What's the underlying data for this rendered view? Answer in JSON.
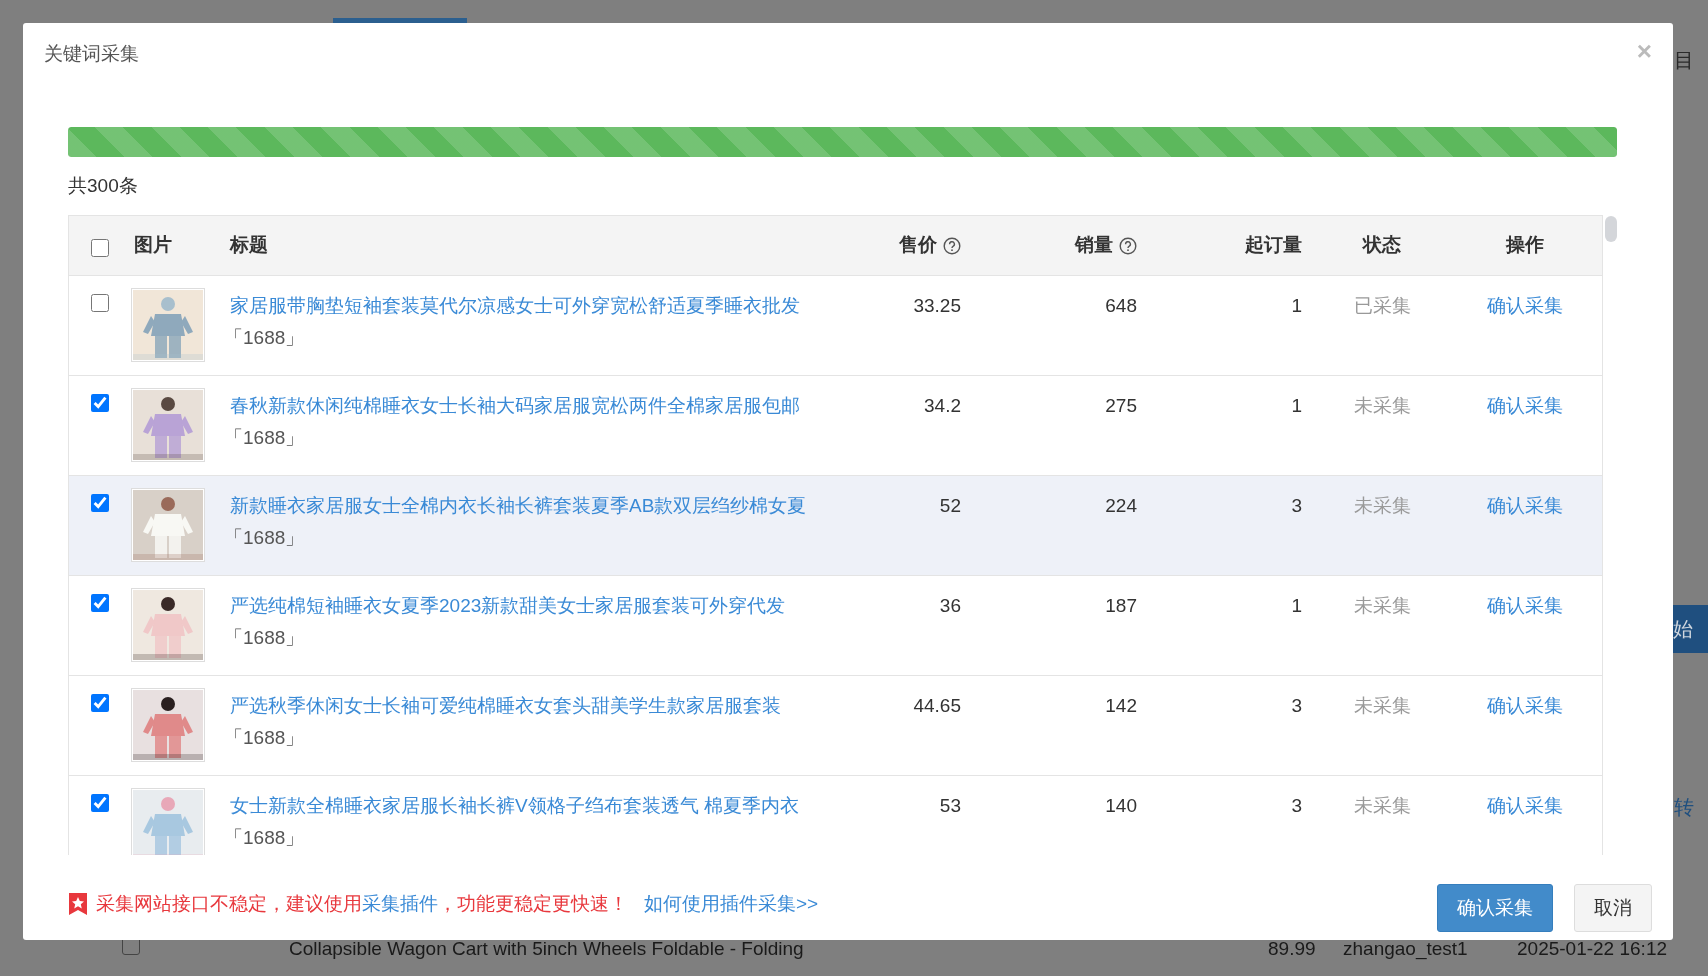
{
  "background": {
    "side_text": "目",
    "side_button": "始",
    "side_link": "转",
    "row": {
      "checked": false,
      "title": "Collapsible Wagon Cart with 5inch Wheels Foldable - Folding",
      "price": "89.99",
      "user": "zhangao_test1",
      "time": "2025-01-22 16:12"
    }
  },
  "dialog": {
    "title": "关键词采集",
    "close": "×",
    "progress": {
      "level": 1
    },
    "total": "共300条",
    "table": {
      "select_all": {
        "checked": false
      },
      "columns": [
        "图片",
        "标题",
        "售价",
        "销量",
        "起订量",
        "状态",
        "操作"
      ],
      "rows": [
        {
          "checked": false,
          "highlighted": false,
          "title": "家居服带胸垫短袖套装莫代尔凉感女士可外穿宽松舒适夏季睡衣批发",
          "source": "「1688」",
          "price": "33.25",
          "sales": "648",
          "moq": "1",
          "status": "已采集",
          "action": "确认采集"
        },
        {
          "checked": true,
          "highlighted": false,
          "title": "春秋新款休闲纯棉睡衣女士长袖大码家居服宽松两件全棉家居服包邮",
          "source": "「1688」",
          "price": "34.2",
          "sales": "275",
          "moq": "1",
          "status": "未采集",
          "action": "确认采集"
        },
        {
          "checked": true,
          "highlighted": true,
          "title": "新款睡衣家居服女士全棉内衣长袖长裤套装夏季AB款双层绉纱棉女夏",
          "source": "「1688」",
          "price": "52",
          "sales": "224",
          "moq": "3",
          "status": "未采集",
          "action": "确认采集"
        },
        {
          "checked": true,
          "highlighted": false,
          "title": "严选纯棉短袖睡衣女夏季2023新款甜美女士家居服套装可外穿代发",
          "source": "「1688」",
          "price": "36",
          "sales": "187",
          "moq": "1",
          "status": "未采集",
          "action": "确认采集"
        },
        {
          "checked": true,
          "highlighted": false,
          "title": "严选秋季休闲女士长袖可爱纯棉睡衣女套头甜美学生款家居服套装",
          "source": "「1688」",
          "price": "44.65",
          "sales": "142",
          "moq": "3",
          "status": "未采集",
          "action": "确认采集"
        },
        {
          "checked": true,
          "highlighted": false,
          "title": "女士新款全棉睡衣家居服长袖长裤V领格子绉布套装透气 棉夏季内衣",
          "source": "「1688」",
          "price": "53",
          "sales": "140",
          "moq": "3",
          "status": "未采集",
          "action": "确认采集"
        }
      ]
    },
    "notice": {
      "text": "采集网站接口不稳定，建议使用",
      "link": "采集插件",
      "text_after": "，功能更稳定更快速！",
      "help_link": "如何使用插件采集>>"
    },
    "buttons": [
      "确认采集",
      "取消"
    ]
  }
}
